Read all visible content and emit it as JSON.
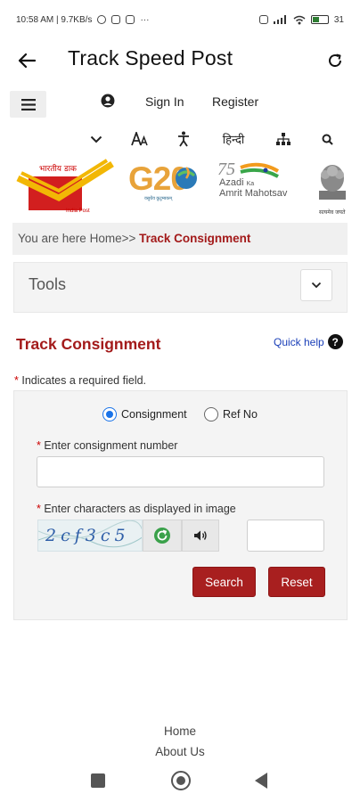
{
  "status_bar": {
    "left_text": "10:58 AM | 9.7KB/s",
    "right_text": "31",
    "battery_level": 0.45
  },
  "app_bar": {
    "title": "Track Speed Post",
    "back_icon": "arrow-left-icon",
    "refresh_icon": "refresh-icon"
  },
  "top_nav": {
    "menu_icon": "hamburger-icon",
    "user_icon": "user-icon",
    "sign_in": "Sign In",
    "register": "Register",
    "icons": [
      "chevron-down-icon",
      "font-size-icon",
      "accessibility-icon",
      "language-icon",
      "sitemap-icon",
      "search-icon"
    ],
    "hindi": "हिन्दी"
  },
  "logos": {
    "india_post": "भारतीय डाक",
    "india_post_sub": "India Post",
    "g20": "G20",
    "g20_sub": "वसुधैव कुटुम्बकम्",
    "azadi_line1": "Azadi",
    "azadi_ka": "Ka",
    "azadi_line2": "Amrit Mahotsav",
    "emblem_caption": "सत्यमेव जयते"
  },
  "breadcrumb": {
    "prefix": "You are here Home>> ",
    "current": "Track Consignment"
  },
  "tools": {
    "label": "Tools"
  },
  "section": {
    "title": "Track Consignment",
    "quick_help": "Quick help",
    "help_glyph": "?"
  },
  "form": {
    "required_star": "*",
    "required_note": " Indicates a required field.",
    "radio_consignment": "Consignment",
    "radio_ref": "Ref No",
    "selected": "Consignment",
    "consignment_label": " Enter consignment number",
    "consignment_value": "",
    "captcha_label": " Enter characters as displayed in image",
    "captcha_text": "2cf3c5",
    "captcha_value": "",
    "search_button": "Search",
    "reset_button": "Reset"
  },
  "footer": {
    "home": "Home",
    "about": "About Us"
  },
  "colors": {
    "accent_red": "#a31a1a",
    "button_red": "#a81f1f",
    "link_blue": "#1a3fb8",
    "radio_blue": "#1a73e8"
  }
}
